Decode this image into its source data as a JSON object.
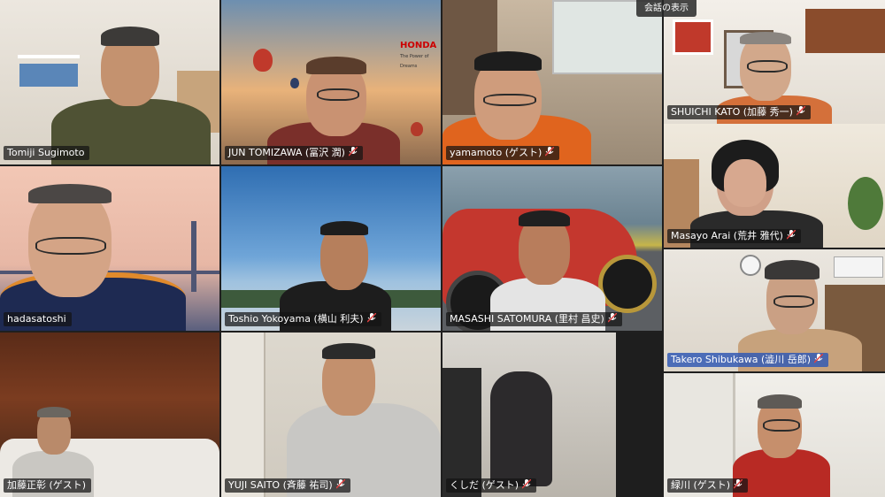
{
  "top_bar": {
    "show_conversation_label": "会話の表示"
  },
  "brand_sign": {
    "text": "HONDA",
    "sub": "The Power of Dreams"
  },
  "participants": [
    {
      "name": "Tomiji Sugimoto",
      "muted": false,
      "active": false
    },
    {
      "name": "JUN TOMIZAWA (冨沢 潤)",
      "muted": true,
      "active": false
    },
    {
      "name": "yamamoto (ゲスト)",
      "muted": true,
      "active": false
    },
    {
      "name": "SHUICHI KATO (加藤 秀一)",
      "muted": true,
      "active": false
    },
    {
      "name": "hadasatoshi",
      "muted": false,
      "active": false
    },
    {
      "name": "Toshio Yokoyama (横山 利夫)",
      "muted": true,
      "active": false
    },
    {
      "name": "MASASHI SATOMURA (里村 昌史)",
      "muted": true,
      "active": false
    },
    {
      "name": "Masayo Arai (荒井 雅代)",
      "muted": true,
      "active": false
    },
    {
      "name": "加藤正彰 (ゲスト)",
      "muted": false,
      "active": false
    },
    {
      "name": "YUJI SAITO (斉藤 祐司)",
      "muted": true,
      "active": false
    },
    {
      "name": "くしだ (ゲスト)",
      "muted": true,
      "active": false
    },
    {
      "name": "Takero Shibukawa (澁川 岳郎)",
      "muted": true,
      "active": true
    },
    {
      "name": "緑川 (ゲスト)",
      "muted": true,
      "active": false
    }
  ],
  "icons": {
    "mute": "mic-muted-icon"
  }
}
